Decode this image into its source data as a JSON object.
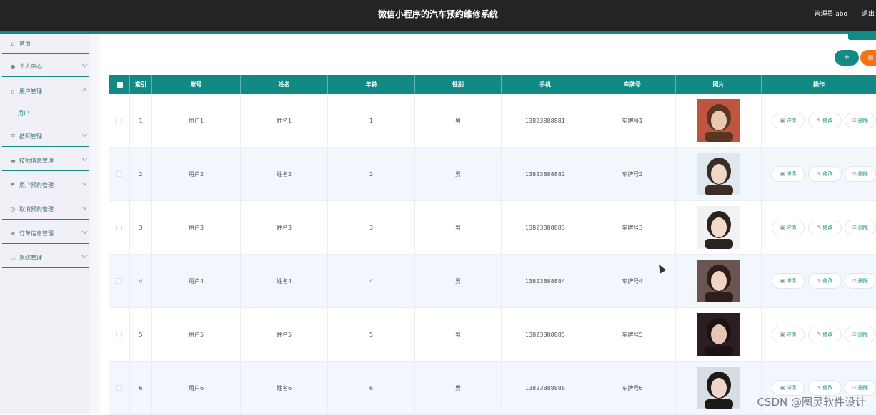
{
  "header": {
    "title": "微信小程序的汽车预约维修系统",
    "user": "管理员 abo",
    "logout": "退出"
  },
  "sidebar": {
    "items": [
      {
        "label": "首页",
        "icon": "home-icon",
        "glyph": "⌂"
      },
      {
        "label": "个人中心",
        "icon": "user-icon",
        "glyph": "●"
      },
      {
        "label": "用户管理",
        "icon": "lock-icon",
        "glyph": "▯"
      },
      {
        "label": "技师管理",
        "icon": "list-icon",
        "glyph": "☰"
      },
      {
        "label": "技师信息管理",
        "icon": "monitor-icon",
        "glyph": "▬"
      },
      {
        "label": "用户预约管理",
        "icon": "flag-icon",
        "glyph": "⚑"
      },
      {
        "label": "取消预约管理",
        "icon": "clock-icon",
        "glyph": "◷"
      },
      {
        "label": "订单信息管理",
        "icon": "sliders-icon",
        "glyph": "≢"
      },
      {
        "label": "系统管理",
        "icon": "chat-icon",
        "glyph": "▭"
      }
    ],
    "sub_item": "用户"
  },
  "actions": {
    "add": "+",
    "delete": "删"
  },
  "table": {
    "headers": [
      "索引",
      "账号",
      "姓名",
      "年龄",
      "性别",
      "手机",
      "车牌号",
      "照片",
      "操作"
    ],
    "rows": [
      {
        "index": "1",
        "account": "用户1",
        "name": "姓名1",
        "age": "1",
        "gender": "男",
        "phone": "13823888881",
        "plate": "车牌号1"
      },
      {
        "index": "2",
        "account": "用户2",
        "name": "姓名2",
        "age": "2",
        "gender": "男",
        "phone": "13823888882",
        "plate": "车牌号2"
      },
      {
        "index": "3",
        "account": "用户3",
        "name": "姓名3",
        "age": "3",
        "gender": "男",
        "phone": "13823888883",
        "plate": "车牌号3"
      },
      {
        "index": "4",
        "account": "用户4",
        "name": "姓名4",
        "age": "4",
        "gender": "男",
        "phone": "13823888884",
        "plate": "车牌号4"
      },
      {
        "index": "5",
        "account": "用户5",
        "name": "姓名5",
        "age": "5",
        "gender": "男",
        "phone": "13823888885",
        "plate": "车牌号5"
      },
      {
        "index": "6",
        "account": "用户6",
        "name": "姓名6",
        "age": "6",
        "gender": "男",
        "phone": "13823888886",
        "plate": "车牌号6"
      }
    ],
    "ops": {
      "detail": "详情",
      "edit": "修改",
      "delete": "删除"
    }
  },
  "watermark": "CSDN @图灵软件设计",
  "colors": {
    "teal": "#138a84",
    "orange": "#f37216",
    "topbar": "#222425"
  }
}
